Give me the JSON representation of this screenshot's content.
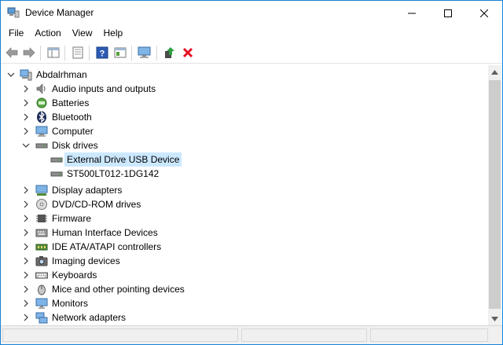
{
  "window": {
    "title": "Device Manager",
    "accent": "#1883d7"
  },
  "menu": [
    "File",
    "Action",
    "View",
    "Help"
  ],
  "toolbar": {
    "buttons": [
      "back-icon",
      "forward-icon",
      "show-hide-tree-icon",
      "properties-icon",
      "help-icon",
      "view-icon",
      "monitor-icon",
      "update-driver-icon",
      "uninstall-icon"
    ]
  },
  "tree": {
    "root": "Abdalrhman",
    "items": [
      {
        "label": "Audio inputs and outputs",
        "icon": "speaker-icon",
        "expanded": false
      },
      {
        "label": "Batteries",
        "icon": "battery-icon",
        "expanded": false
      },
      {
        "label": "Bluetooth",
        "icon": "bluetooth-icon",
        "expanded": false
      },
      {
        "label": "Computer",
        "icon": "computer-icon",
        "expanded": false
      },
      {
        "label": "Disk drives",
        "icon": "disk-drive-icon",
        "expanded": true
      },
      {
        "label": "External Drive USB Device",
        "icon": "disk-drive-icon",
        "child": true,
        "selected": true
      },
      {
        "label": "ST500LT012-1DG142",
        "icon": "disk-drive-icon",
        "child": true
      },
      {
        "label": "Display adapters",
        "icon": "display-adapter-icon",
        "expanded": false
      },
      {
        "label": "DVD/CD-ROM drives",
        "icon": "dvd-icon",
        "expanded": false
      },
      {
        "label": "Firmware",
        "icon": "firmware-icon",
        "expanded": false
      },
      {
        "label": "Human Interface Devices",
        "icon": "hid-icon",
        "expanded": false
      },
      {
        "label": "IDE ATA/ATAPI controllers",
        "icon": "ide-icon",
        "expanded": false
      },
      {
        "label": "Imaging devices",
        "icon": "camera-icon",
        "expanded": false
      },
      {
        "label": "Keyboards",
        "icon": "keyboard-icon",
        "expanded": false
      },
      {
        "label": "Mice and other pointing devices",
        "icon": "mouse-icon",
        "expanded": false
      },
      {
        "label": "Monitors",
        "icon": "monitor-icon",
        "expanded": false
      },
      {
        "label": "Network adapters",
        "icon": "network-icon",
        "expanded": false
      }
    ]
  },
  "colors": {
    "selection": "#cce8ff",
    "uninstall": "#e81123"
  }
}
